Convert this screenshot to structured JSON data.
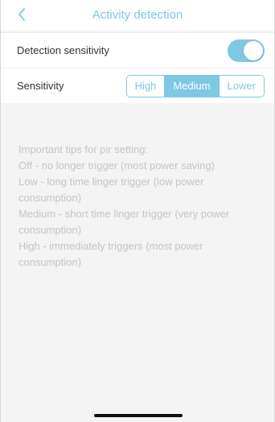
{
  "header": {
    "title": "Activity detection",
    "back_icon": "chevron-left-icon"
  },
  "detection": {
    "label": "Detection sensitivity",
    "enabled": true
  },
  "sensitivity": {
    "label": "Sensitivity",
    "options": [
      "High",
      "Medium",
      "Lower"
    ],
    "selected": "Medium"
  },
  "tips": {
    "heading": "Important tips for pir setting:",
    "lines": [
      "Off - no longer trigger (most power saving)",
      "Low - long time linger trigger (low power consumption)",
      "Medium - short time linger trigger (very power consumption)",
      "High - immediately triggers (most power consumption)"
    ]
  },
  "colors": {
    "accent": "#7ec8e3",
    "background": "#f4f4f4",
    "tip_text": "#c5c5c5"
  }
}
